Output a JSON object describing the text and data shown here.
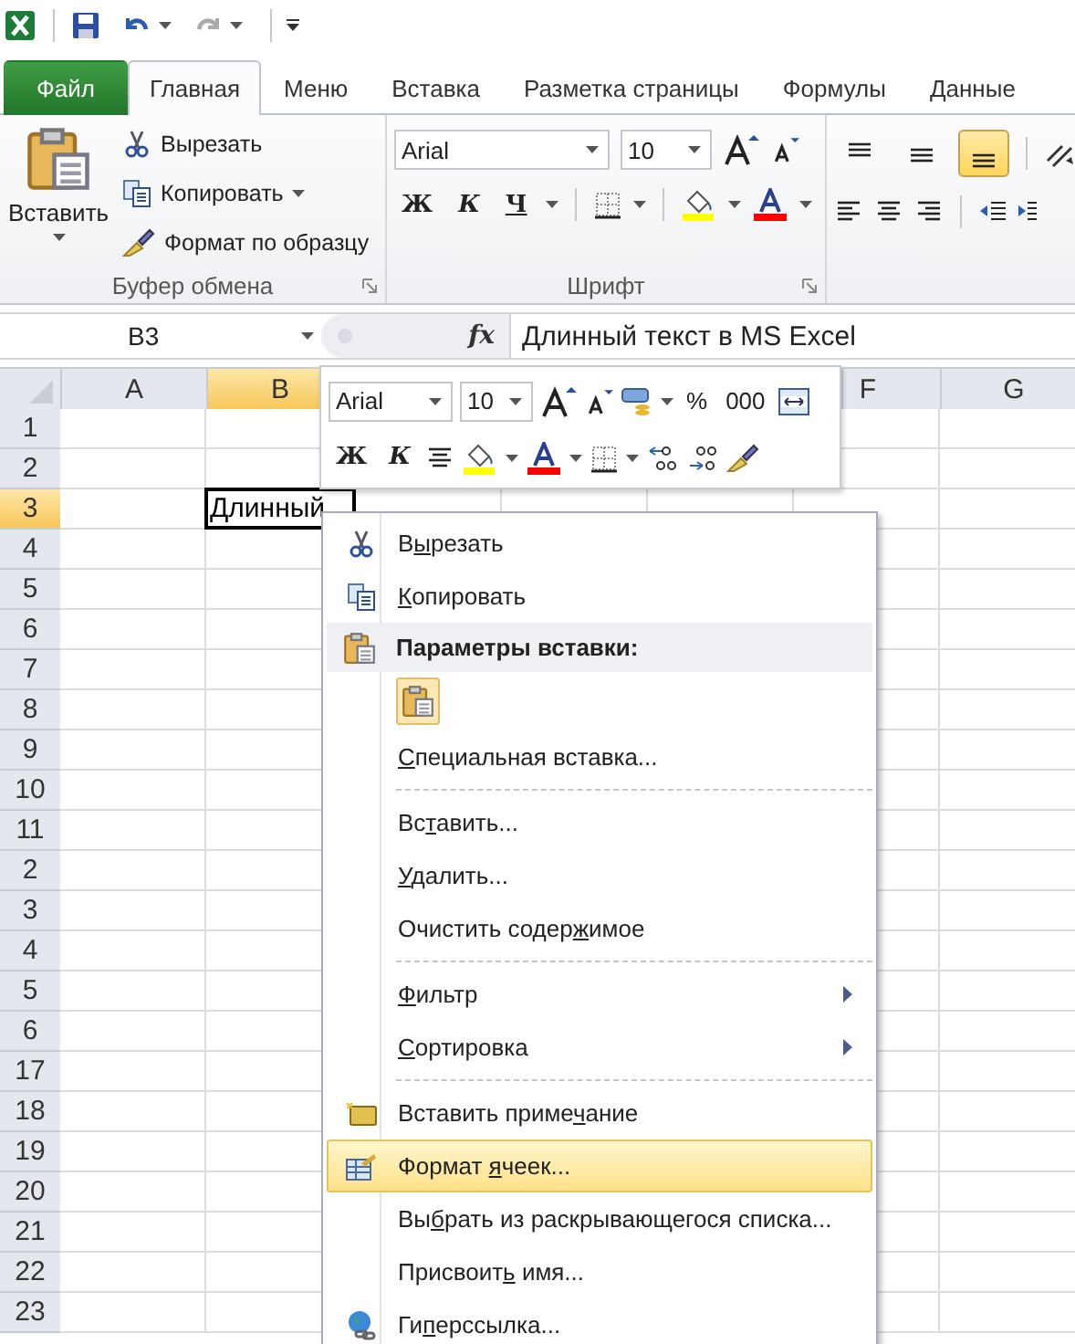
{
  "quick_access": [
    {
      "kind": "save",
      "disabled": false,
      "dropdown": false
    },
    {
      "kind": "undo",
      "disabled": false,
      "dropdown": true
    },
    {
      "kind": "redo",
      "disabled": true,
      "dropdown": true
    },
    {
      "kind": "customize",
      "disabled": false,
      "dropdown": false
    }
  ],
  "tabs": [
    {
      "label": "Файл",
      "kind": "file",
      "selected": false
    },
    {
      "label": "Главная",
      "kind": "tab",
      "selected": true
    },
    {
      "label": "Меню",
      "kind": "tab",
      "selected": false
    },
    {
      "label": "Вставка",
      "kind": "tab",
      "selected": false
    },
    {
      "label": "Разметка страницы",
      "kind": "tab",
      "selected": false
    },
    {
      "label": "Формулы",
      "kind": "tab",
      "selected": false
    },
    {
      "label": "Данные",
      "kind": "tab",
      "selected": false
    }
  ],
  "ribbon": {
    "clipboard": {
      "label": "Буфер обмена",
      "paste": "Вставить",
      "cut": "Вырезать",
      "copy": "Копировать",
      "format_painter": "Формат по образцу"
    },
    "font": {
      "label": "Шрифт",
      "font_name": "Arial",
      "font_size": "10",
      "bold": "Ж",
      "italic": "К",
      "underline": "Ч"
    },
    "alignment": {
      "vertical": [
        {
          "kind": "top",
          "selected": false
        },
        {
          "kind": "middle",
          "selected": false
        },
        {
          "kind": "bottom",
          "selected": true
        }
      ]
    }
  },
  "formula_bar": {
    "name_box": "B3",
    "function_label": "fx",
    "value": "Длинный текст в MS Excel"
  },
  "sheet": {
    "columns": [
      {
        "kind": "header",
        "label": "A",
        "selected": false
      },
      {
        "kind": "header",
        "label": "B",
        "selected": true
      },
      {
        "kind": "covered"
      },
      {
        "kind": "covered"
      },
      {
        "kind": "covered"
      },
      {
        "kind": "header",
        "label": "F",
        "selected": false
      },
      {
        "kind": "header",
        "label": "G",
        "selected": false
      }
    ],
    "rows": [
      {
        "label": "1",
        "selected": false
      },
      {
        "label": "2",
        "selected": false
      },
      {
        "label": "3",
        "selected": true
      },
      {
        "label": "4",
        "selected": false
      },
      {
        "label": "5",
        "selected": false
      },
      {
        "label": "6",
        "selected": false
      },
      {
        "label": "7",
        "selected": false
      },
      {
        "label": "8",
        "selected": false
      },
      {
        "label": "9",
        "selected": false
      },
      {
        "label": "10",
        "selected": false
      },
      {
        "label": "11",
        "selected": false
      },
      {
        "label": "2",
        "selected": false
      },
      {
        "label": "3",
        "selected": false
      },
      {
        "label": "4",
        "selected": false
      },
      {
        "label": "5",
        "selected": false
      },
      {
        "label": "6",
        "selected": false
      },
      {
        "label": "17",
        "selected": false
      },
      {
        "label": "18",
        "selected": false
      },
      {
        "label": "19",
        "selected": false
      },
      {
        "label": "20",
        "selected": false
      },
      {
        "label": "21",
        "selected": false
      },
      {
        "label": "22",
        "selected": false
      },
      {
        "label": "23",
        "selected": false
      }
    ],
    "active_cell_text": "Длинный"
  },
  "mini_toolbar": {
    "font_name": "Arial",
    "font_size": "10",
    "percent": "%",
    "thousands": "000",
    "bold": "Ж",
    "italic": "К"
  },
  "context_menu": {
    "items": [
      {
        "kind": "command",
        "label": {
          "before": "В",
          "key": "ы",
          "after": "резать"
        },
        "selected": false,
        "submenu": false
      },
      {
        "kind": "command",
        "label": {
          "key": "К",
          "after": "опировать"
        },
        "selected": false,
        "submenu": false
      },
      {
        "kind": "header",
        "label": "Параметры вставки:"
      },
      {
        "kind": "paste_options"
      },
      {
        "kind": "command",
        "label": {
          "key": "С",
          "after": "пециальная вставка..."
        },
        "selected": false,
        "submenu": false
      },
      {
        "kind": "separator"
      },
      {
        "kind": "command",
        "label": {
          "before": "Вс",
          "key": "т",
          "after": "авить..."
        },
        "selected": false,
        "submenu": false
      },
      {
        "kind": "command",
        "label": {
          "key": "У",
          "after": "далить..."
        },
        "selected": false,
        "submenu": false
      },
      {
        "kind": "command",
        "label": {
          "before": "Очистить содер",
          "key": "ж",
          "after": "имое"
        },
        "selected": false,
        "submenu": false
      },
      {
        "kind": "separator"
      },
      {
        "kind": "command",
        "label": {
          "key": "Ф",
          "after": "ильтр"
        },
        "selected": false,
        "submenu": true
      },
      {
        "kind": "command",
        "label": {
          "key": "С",
          "after": "ортировка"
        },
        "selected": false,
        "submenu": true
      },
      {
        "kind": "separator"
      },
      {
        "kind": "command",
        "label": {
          "before": "Вставить приме",
          "key": "ч",
          "after": "ание"
        },
        "selected": false,
        "submenu": false
      },
      {
        "kind": "command",
        "label": {
          "before": "Формат ",
          "key": "я",
          "after": "чеек..."
        },
        "selected": true,
        "submenu": false
      },
      {
        "kind": "command",
        "label": {
          "before": "Вы",
          "key": "б",
          "after": "рать из раскрывающегося списка..."
        },
        "selected": false,
        "submenu": false
      },
      {
        "kind": "command",
        "label": {
          "before": "Присвоит",
          "key": "ь",
          "after": " имя..."
        },
        "selected": false,
        "submenu": false
      },
      {
        "kind": "command",
        "label": {
          "before": "Ги",
          "key": "п",
          "after": "ерссылка..."
        },
        "selected": false,
        "submenu": false
      }
    ]
  }
}
